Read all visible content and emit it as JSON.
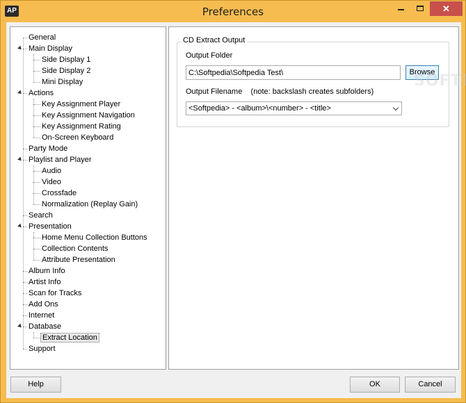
{
  "window": {
    "title": "Preferences",
    "app_icon_text": "AP",
    "close_glyph": "✕"
  },
  "tree": [
    {
      "label": "General",
      "level": 0,
      "expanded": false
    },
    {
      "label": "Main Display",
      "level": 0,
      "expanded": true
    },
    {
      "label": "Side Display 1",
      "level": 1
    },
    {
      "label": "Side Display 2",
      "level": 1
    },
    {
      "label": "Mini Display",
      "level": 1
    },
    {
      "label": "Actions",
      "level": 0,
      "expanded": true
    },
    {
      "label": "Key Assignment Player",
      "level": 1
    },
    {
      "label": "Key Assignment Navigation",
      "level": 1
    },
    {
      "label": "Key Assignment Rating",
      "level": 1
    },
    {
      "label": "On-Screen Keyboard",
      "level": 1
    },
    {
      "label": "Party Mode",
      "level": 0
    },
    {
      "label": "Playlist and Player",
      "level": 0,
      "expanded": true
    },
    {
      "label": "Audio",
      "level": 1
    },
    {
      "label": "Video",
      "level": 1
    },
    {
      "label": "Crossfade",
      "level": 1
    },
    {
      "label": "Normalization (Replay Gain)",
      "level": 1
    },
    {
      "label": "Search",
      "level": 0
    },
    {
      "label": "Presentation",
      "level": 0,
      "expanded": true
    },
    {
      "label": "Home Menu Collection Buttons",
      "level": 1
    },
    {
      "label": "Collection Contents",
      "level": 1
    },
    {
      "label": "Attribute Presentation",
      "level": 1
    },
    {
      "label": "Album Info",
      "level": 0
    },
    {
      "label": "Artist Info",
      "level": 0
    },
    {
      "label": "Scan for Tracks",
      "level": 0
    },
    {
      "label": "Add Ons",
      "level": 0
    },
    {
      "label": "Internet",
      "level": 0
    },
    {
      "label": "Database",
      "level": 0,
      "expanded": true
    },
    {
      "label": "Extract Location",
      "level": 1,
      "selected": true
    },
    {
      "label": "Support",
      "level": 0
    }
  ],
  "panel": {
    "group_title": "CD Extract Output",
    "output_folder_label": "Output Folder",
    "output_folder_value": "C:\\Softpedia\\Softpedia Test\\",
    "browse_label": "Browse",
    "output_filename_label": "Output Filename    (note: backslash creates subfolders)",
    "output_filename_value": "<Softpedia> - <album>\\<number> - <title>",
    "watermark": "SOFTPEDIA"
  },
  "buttons": {
    "help": "Help",
    "ok": "OK",
    "cancel": "Cancel"
  }
}
